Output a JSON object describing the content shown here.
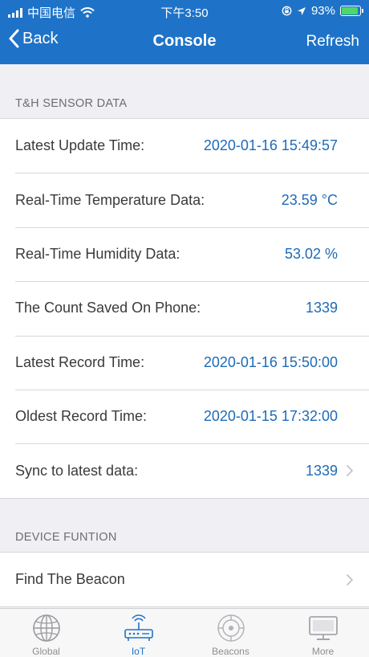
{
  "status_bar": {
    "carrier": "中国电信",
    "time": "下午3:50",
    "battery": "93%",
    "battery_level": 0.93
  },
  "nav": {
    "back_label": "Back",
    "title": "Console",
    "refresh_label": "Refresh"
  },
  "sensor_section": {
    "header": "T&H SENSOR DATA",
    "rows": [
      {
        "label": "Latest Update Time:",
        "value": "2020-01-16 15:49:57"
      },
      {
        "label": "Real-Time Temperature Data:",
        "value": "23.59 °C"
      },
      {
        "label": "Real-Time Humidity Data:",
        "value": "53.02 %"
      },
      {
        "label": "The Count Saved On Phone:",
        "value": "1339"
      },
      {
        "label": "Latest Record Time:",
        "value": "2020-01-16 15:50:00"
      },
      {
        "label": "Oldest Record Time:",
        "value": "2020-01-15 17:32:00"
      },
      {
        "label": "Sync to latest data:",
        "value": "1339"
      }
    ]
  },
  "device_section": {
    "header": "DEVICE FUNTION",
    "rows": [
      {
        "label": "Find The Beacon"
      }
    ]
  },
  "tabs": [
    {
      "label": "Global",
      "icon": "globe-icon"
    },
    {
      "label": "IoT",
      "icon": "router-icon"
    },
    {
      "label": "Beacons",
      "icon": "beacon-icon"
    },
    {
      "label": "More",
      "icon": "monitor-icon"
    }
  ],
  "colors": {
    "accent": "#1e73c8",
    "value_text": "#1e6bb8",
    "background": "#efeff4",
    "battery": "#4cd964"
  }
}
